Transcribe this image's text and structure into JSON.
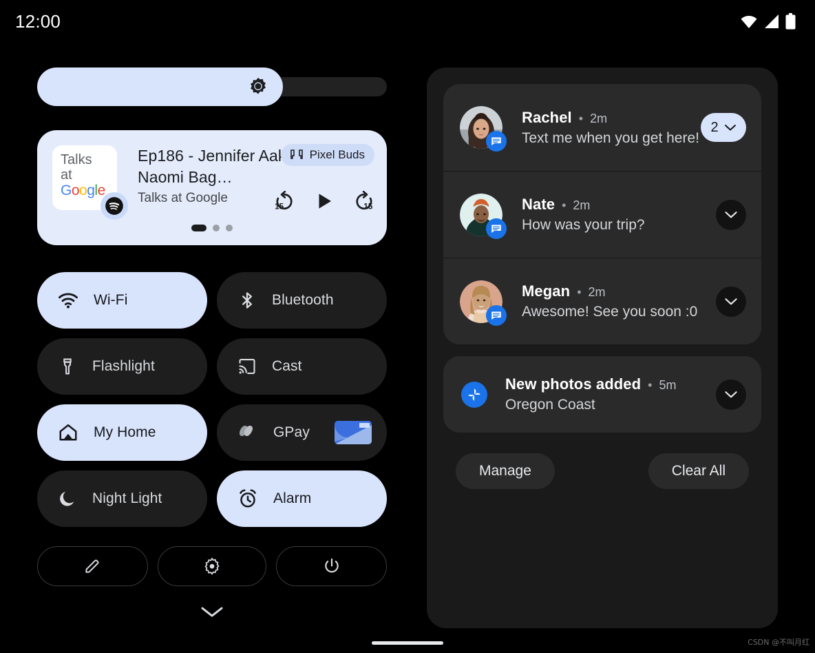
{
  "status_bar": {
    "clock": "12:00",
    "icons": [
      "wifi-icon",
      "cellular-signal-icon",
      "battery-icon"
    ]
  },
  "brightness": {
    "name": "brightness-slider",
    "icon": "brightness-sun-icon",
    "level_percent": 70
  },
  "media_player": {
    "album_art_text_line1": "Talks",
    "album_art_text_line2": "at",
    "album_art_logo": "Google",
    "app_badge_icon": "spotify-icon",
    "title": "Ep186 - Jennifer Aaker & Naomi Bag…",
    "artist": "Talks at Google",
    "output_chip": {
      "icon": "earbuds-icon",
      "label": "Pixel Buds"
    },
    "controls": [
      {
        "name": "replay-15-button",
        "label": "15"
      },
      {
        "name": "play-button",
        "label": ""
      },
      {
        "name": "forward-15-button",
        "label": "15"
      }
    ],
    "page_dots": {
      "total": 3,
      "active_index": 0
    }
  },
  "tiles": [
    {
      "label": "Wi-Fi",
      "icon": "wifi-icon",
      "active": true
    },
    {
      "label": "Bluetooth",
      "icon": "bluetooth-icon",
      "active": false
    },
    {
      "label": "Flashlight",
      "icon": "flashlight-icon",
      "active": false
    },
    {
      "label": "Cast",
      "icon": "cast-icon",
      "active": false
    },
    {
      "label": "My Home",
      "icon": "home-icon",
      "active": true
    },
    {
      "label": "GPay",
      "icon": "gpay-icon",
      "active": false,
      "thumbnail": "bank-card-thumbnail"
    },
    {
      "label": "Night Light",
      "icon": "moon-icon",
      "active": false
    },
    {
      "label": "Alarm",
      "icon": "alarm-clock-icon",
      "active": true
    }
  ],
  "footer_buttons": [
    {
      "name": "edit-tiles-button",
      "icon": "pencil-icon"
    },
    {
      "name": "settings-button",
      "icon": "gear-icon"
    },
    {
      "name": "power-button",
      "icon": "power-icon"
    }
  ],
  "collapse_handle": {
    "icon": "chevron-down-icon"
  },
  "notifications": {
    "conversations": [
      {
        "name": "Rachel",
        "separator": "•",
        "time": "2m",
        "message": "Text me when you get here!",
        "badge_count": "2",
        "has_count_chip": true,
        "app_badge_icon": "messages-icon",
        "avatar": "woman-dark-hair-avatar"
      },
      {
        "name": "Nate",
        "separator": "•",
        "time": "2m",
        "message": "How was your trip?",
        "has_count_chip": false,
        "app_badge_icon": "messages-icon",
        "avatar": "man-orange-beanie-avatar"
      },
      {
        "name": "Megan",
        "separator": "•",
        "time": "2m",
        "message": "Awesome! See you soon :0",
        "has_count_chip": false,
        "app_badge_icon": "messages-icon",
        "avatar": "woman-blonde-avatar"
      }
    ],
    "photos": {
      "title": "New photos added",
      "separator": "•",
      "time": "5m",
      "subtitle": "Oregon Coast",
      "icon": "google-photos-icon"
    },
    "actions": {
      "manage": "Manage",
      "clear_all": "Clear All"
    }
  },
  "watermark": "CSDN @不叫月红",
  "colors": {
    "background": "#000000",
    "tile_off": "#1e1e1e",
    "tile_on": "#d8e3fc",
    "shade": "#1a1a1a",
    "notif_card": "#2a2a2a",
    "accent_blue": "#1a73e8",
    "media_card": "#e4ebfb"
  }
}
